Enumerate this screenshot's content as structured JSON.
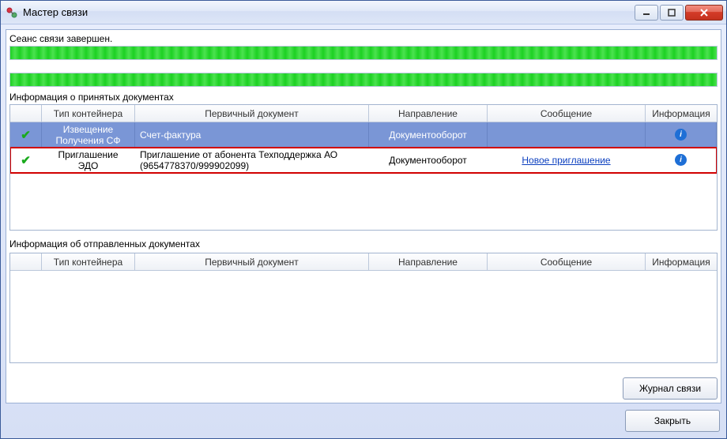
{
  "window": {
    "title": "Мастер связи"
  },
  "session": {
    "status_label": "Сеанс связи завершен."
  },
  "received": {
    "section_label": "Информация о принятых документах",
    "columns": {
      "status": "",
      "type": "Тип контейнера",
      "doc": "Первичный документ",
      "dir": "Направление",
      "msg": "Сообщение",
      "info": "Информация"
    },
    "rows": [
      {
        "type": "Извещение Получения СФ",
        "doc": "Счет-фактура",
        "dir": "Документооборот",
        "msg": ""
      },
      {
        "type": "Приглашение ЭДО",
        "doc": "Приглашение от абонента Техподдержка АО (9654778370/999902099)",
        "dir": "Документооборот",
        "msg": "Новое приглашение"
      }
    ]
  },
  "sent": {
    "section_label": "Информация об отправленных документах",
    "columns": {
      "status": "",
      "type": "Тип контейнера",
      "doc": "Первичный документ",
      "dir": "Направление",
      "msg": "Сообщение",
      "info": "Информация"
    }
  },
  "buttons": {
    "log": "Журнал связи",
    "close": "Закрыть"
  }
}
